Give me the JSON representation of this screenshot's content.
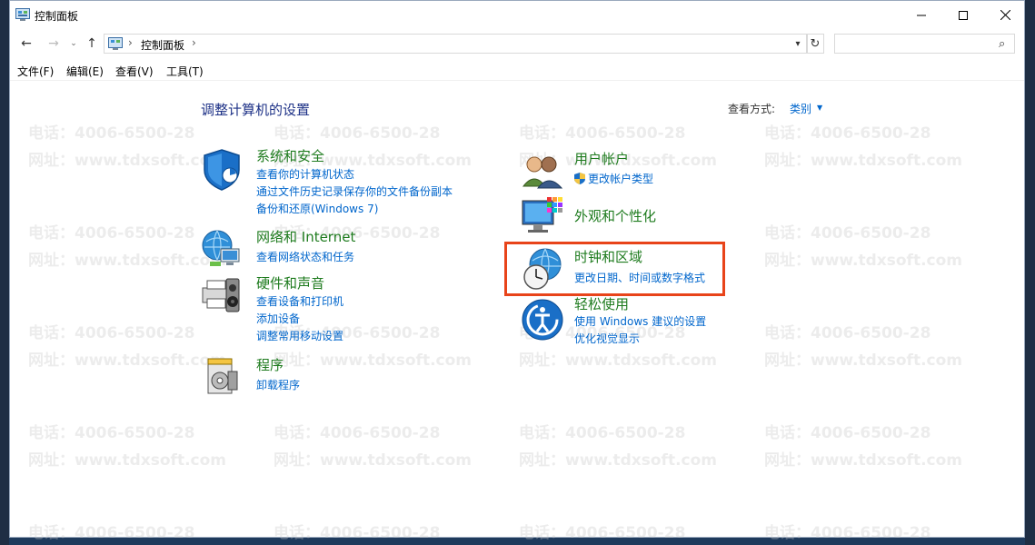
{
  "window": {
    "title": "控制面板"
  },
  "address": {
    "crumb": "控制面板",
    "search_placeholder": ""
  },
  "menu": [
    "文件(F)",
    "编辑(E)",
    "查看(V)",
    "工具(T)"
  ],
  "main": {
    "heading": "调整计算机的设置",
    "view_by_label": "查看方式:",
    "view_by_value": "类别"
  },
  "categories": [
    {
      "title": "系统和安全",
      "links": [
        "查看你的计算机状态",
        "通过文件历史记录保存你的文件备份副本",
        "备份和还原(Windows 7)"
      ]
    },
    {
      "title": "网络和 Internet",
      "links": [
        "查看网络状态和任务"
      ]
    },
    {
      "title": "硬件和声音",
      "links": [
        "查看设备和打印机",
        "添加设备",
        "调整常用移动设置"
      ]
    },
    {
      "title": "程序",
      "links": [
        "卸载程序"
      ]
    },
    {
      "title": "用户帐户",
      "links": [
        "更改帐户类型"
      ]
    },
    {
      "title": "外观和个性化",
      "links": []
    },
    {
      "title": "时钟和区域",
      "links": [
        "更改日期、时间或数字格式"
      ]
    },
    {
      "title": "轻松使用",
      "links": [
        "使用 Windows 建议的设置",
        "优化视觉显示"
      ]
    }
  ],
  "watermark": {
    "phone": "电话：4006-6500-28",
    "site": "网址：www.tdxsoft.com"
  },
  "colors": {
    "accent_link": "#0066cc",
    "category_title": "#1e7b1e",
    "highlight": "#e8441a"
  }
}
